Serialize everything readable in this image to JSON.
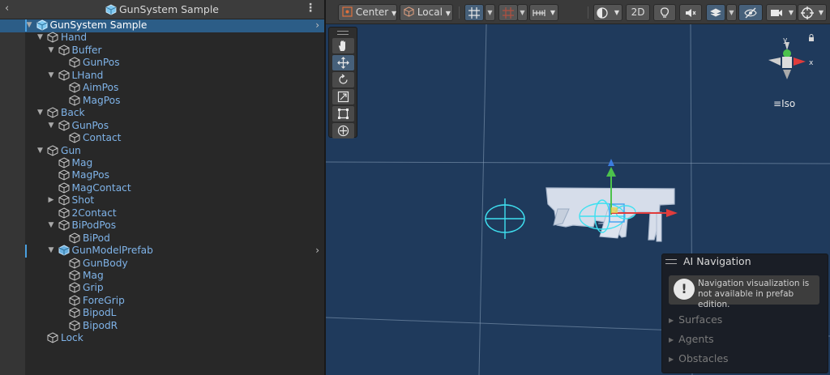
{
  "hierarchy": {
    "title": "GunSystem Sample",
    "rows": [
      {
        "label": "GunSystem Sample",
        "depth": 0,
        "expand": "open",
        "selected": true,
        "arrow": true,
        "icon": "prefab-root-icon"
      },
      {
        "label": "Hand",
        "depth": 1,
        "expand": "open"
      },
      {
        "label": "Buffer",
        "depth": 2,
        "expand": "open"
      },
      {
        "label": "GunPos",
        "depth": 3,
        "expand": "none"
      },
      {
        "label": "LHand",
        "depth": 2,
        "expand": "open"
      },
      {
        "label": "AimPos",
        "depth": 3,
        "expand": "none"
      },
      {
        "label": "MagPos",
        "depth": 3,
        "expand": "none"
      },
      {
        "label": "Back",
        "depth": 1,
        "expand": "open"
      },
      {
        "label": "GunPos",
        "depth": 2,
        "expand": "open"
      },
      {
        "label": "Contact",
        "depth": 3,
        "expand": "none"
      },
      {
        "label": "Gun",
        "depth": 1,
        "expand": "open"
      },
      {
        "label": "Mag",
        "depth": 2,
        "expand": "none"
      },
      {
        "label": "MagPos",
        "depth": 2,
        "expand": "none"
      },
      {
        "label": "MagContact",
        "depth": 2,
        "expand": "none"
      },
      {
        "label": "Shot",
        "depth": 2,
        "expand": "closed"
      },
      {
        "label": "2Contact",
        "depth": 2,
        "expand": "none"
      },
      {
        "label": "BiPodPos",
        "depth": 2,
        "expand": "open"
      },
      {
        "label": "BiPod",
        "depth": 3,
        "expand": "none"
      },
      {
        "label": "GunModelPrefab",
        "depth": 2,
        "expand": "open",
        "arrow": true,
        "icon": "prefab-model-icon",
        "marker": true
      },
      {
        "label": "GunBody",
        "depth": 3,
        "expand": "none"
      },
      {
        "label": "Mag",
        "depth": 3,
        "expand": "none"
      },
      {
        "label": "Grip",
        "depth": 3,
        "expand": "none"
      },
      {
        "label": "ForeGrip",
        "depth": 3,
        "expand": "none"
      },
      {
        "label": "BipodL",
        "depth": 3,
        "expand": "none"
      },
      {
        "label": "BipodR",
        "depth": 3,
        "expand": "none"
      },
      {
        "label": "Lock",
        "depth": 1,
        "expand": "none"
      }
    ]
  },
  "toolbar": {
    "pivot_label": "Center",
    "space_label": "Local",
    "mode_2d_label": "2D"
  },
  "orientation": {
    "axis_y": "y",
    "axis_x": "x",
    "projection_label": "Iso"
  },
  "ai_navigation": {
    "title": "AI Navigation",
    "alert_text": "Navigation visualization is not available in prefab edition.",
    "sections": [
      "Surfaces",
      "Agents",
      "Obstacles"
    ]
  },
  "colors": {
    "selection": "#2c5d87",
    "scene_bg": "#1f3a5c",
    "label_blue": "#7fb3e8",
    "gizmo_cyan": "#3fe0f0",
    "axis_x": "#e03c3c",
    "axis_y": "#4cc24c",
    "axis_z": "#3c7ce0"
  }
}
